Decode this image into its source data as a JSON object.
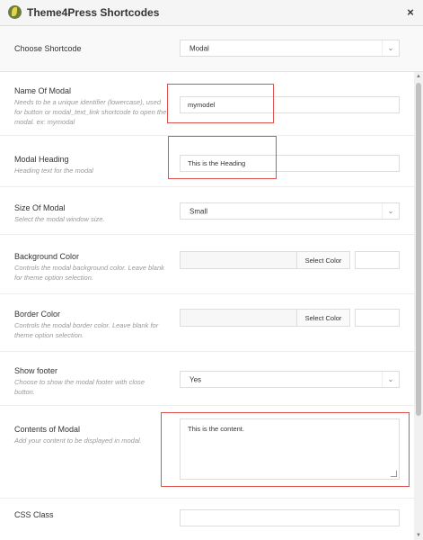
{
  "window": {
    "title": "Theme4Press Shortcodes",
    "close_glyph": "×",
    "logo_icon": "theme4press-leaf-icon"
  },
  "choose": {
    "label": "Choose Shortcode",
    "value": "Modal",
    "caret": "⌄"
  },
  "fields": {
    "name": {
      "label": "Name Of Modal",
      "description": "Needs to be a unique identifier (lowercase), used for button or modal_text_link shortcode to open the modal. ex: mymodal",
      "value": "mymodel"
    },
    "heading": {
      "label": "Modal Heading",
      "description": "Heading text for the modal",
      "value": "This is the Heading"
    },
    "size": {
      "label": "Size Of Modal",
      "description": "Select the modal window size.",
      "value": "Small",
      "caret": "⌄"
    },
    "bg_color": {
      "label": "Background Color",
      "description": "Controls the modal background color. Leave blank for theme option selection.",
      "button": "Select Color"
    },
    "border_color": {
      "label": "Border Color",
      "description": "Controls the modal border color. Leave blank for theme option selection.",
      "button": "Select Color"
    },
    "footer": {
      "label": "Show footer",
      "description": "Choose to show the modal footer with close button.",
      "value": "Yes",
      "caret": "⌄"
    },
    "contents": {
      "label": "Contents of Modal",
      "description": "Add your content to be displayed in modal.",
      "value": "This is the content."
    },
    "css_class": {
      "label": "CSS Class"
    }
  },
  "colors": {
    "highlight": "#d9534f",
    "titlebar": "#f5f5f5",
    "border": "#dddddd"
  }
}
